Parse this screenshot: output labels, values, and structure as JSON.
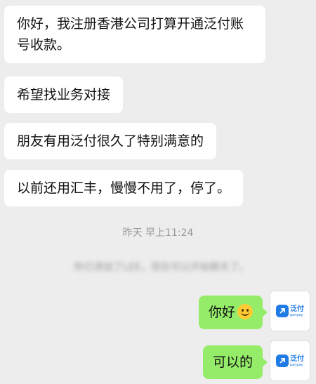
{
  "messages_in": [
    {
      "text": "你好，我注册香港公司打算开通泛付账号收款。"
    },
    {
      "text": "希望找业务对接"
    },
    {
      "text": "朋友有用泛付很久了特别满意的"
    },
    {
      "text": "以前还用汇丰，慢慢不用了，停了。"
    }
  ],
  "timestamp": "昨天 早上11:24",
  "system_notice_blurred": "你已添加了LEE，现在可以开始聊天了。",
  "messages_out": [
    {
      "text": "你好",
      "emoji": "smiling-face"
    },
    {
      "text": "可以的"
    }
  ],
  "avatar": {
    "brand_cn": "泛付",
    "brand_en": "panpay"
  },
  "colors": {
    "background": "#ededed",
    "outgoing_bubble": "#95ec69",
    "incoming_bubble": "#ffffff",
    "brand_blue": "#1f7be6"
  }
}
